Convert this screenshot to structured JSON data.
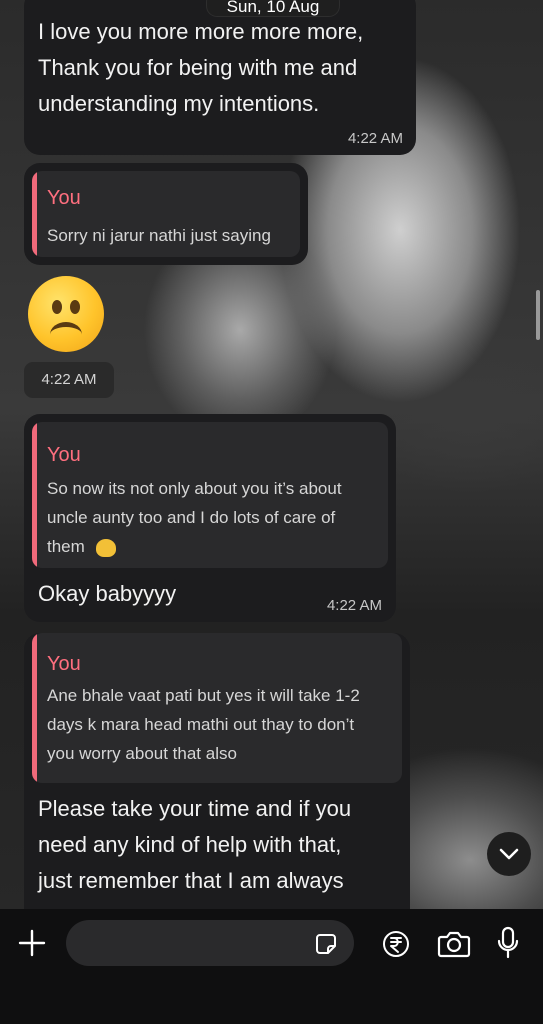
{
  "header": {
    "date": "Sun, 10 Aug"
  },
  "messages": {
    "m1": {
      "lines": [
        "I love you more more more more,",
        "Thank you for being with me and",
        "understanding my intentions."
      ],
      "time": "4:22 AM"
    },
    "m2": {
      "quote_author": "You",
      "quote_text": "Sorry ni jarur nathi just saying"
    },
    "m3": {
      "emoji": "frowning-face",
      "time": "4:22 AM"
    },
    "m4": {
      "quote_author": "You",
      "quote_lines": [
        "So now its not only about you it’s about",
        "uncle aunty too and I do lots of care of",
        "them"
      ],
      "quote_emoji": "melting-face",
      "text": "Okay babyyyy",
      "time": "4:22 AM"
    },
    "m5": {
      "quote_author": "You",
      "quote_lines": [
        "Ane bhale vaat pati but yes it will take 1-2",
        "days k mara head mathi out thay to don’t",
        "you worry about that also"
      ],
      "lines": [
        "Please take your time and if you",
        "need any kind of help with that,",
        "just remember that I am always"
      ]
    }
  },
  "composer": {
    "icons": [
      "plus-icon",
      "sticker-icon",
      "rupee-icon",
      "camera-icon",
      "microphone-icon"
    ],
    "input_value": ""
  },
  "colors": {
    "quote_accent": "#f06a7b",
    "bubble": "#1c1c1e",
    "composer_bg": "#0f0f10"
  }
}
